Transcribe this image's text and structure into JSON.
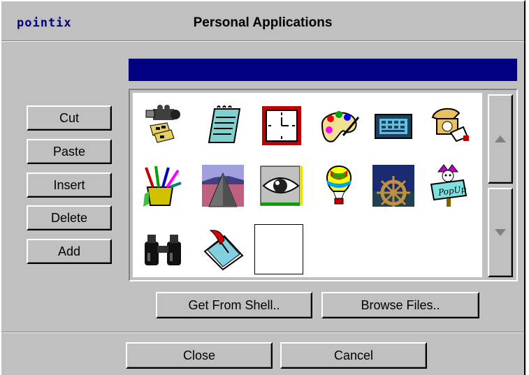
{
  "window": {
    "brand": "pointix",
    "title": "Personal Applications"
  },
  "colors": {
    "face": "#c0c0c0",
    "highlight": "#000080",
    "well": "#ffffff"
  },
  "side_buttons": [
    {
      "label": "Cut",
      "name": "cut-button"
    },
    {
      "label": "Paste",
      "name": "paste-button"
    },
    {
      "label": "Insert",
      "name": "insert-button"
    },
    {
      "label": "Delete",
      "name": "delete-button"
    },
    {
      "label": "Add",
      "name": "add-button"
    }
  ],
  "source_buttons": {
    "get_from_shell": "Get From Shell..",
    "browse_files": "Browse Files.."
  },
  "footer": {
    "close": "Close",
    "cancel": "Cancel"
  },
  "icons": [
    "video-camera-icon",
    "notepad-icon",
    "clock-icon",
    "paint-palette-icon",
    "calculator-icon",
    "telephone-icon",
    "pencil-cup-icon",
    "pyramid-road-icon",
    "eye-icon",
    "hot-air-balloon-icon",
    "ship-wheel-icon",
    "popup-jester-icon",
    "binoculars-icon",
    "quill-document-icon"
  ],
  "scrollbar": {
    "up_icon": "arrow-up-icon",
    "down_icon": "arrow-down-icon"
  }
}
